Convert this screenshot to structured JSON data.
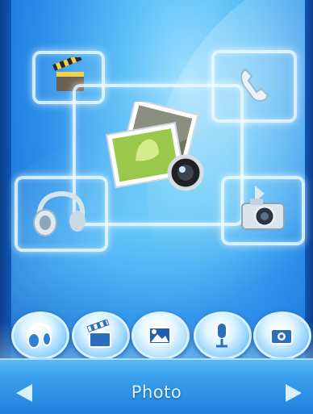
{
  "menu": {
    "current_title": "Photo",
    "items": [
      {
        "name": "music",
        "icon": "headphones-icon"
      },
      {
        "name": "video",
        "icon": "clapperboard-icon"
      },
      {
        "name": "photo",
        "icon": "photo-icon"
      },
      {
        "name": "record",
        "icon": "microphone-icon"
      },
      {
        "name": "camera",
        "icon": "camera-icon"
      }
    ]
  },
  "colors": {
    "background": "#2d8fea",
    "bar": "#1f7fdc",
    "label": "#dff3ff"
  }
}
